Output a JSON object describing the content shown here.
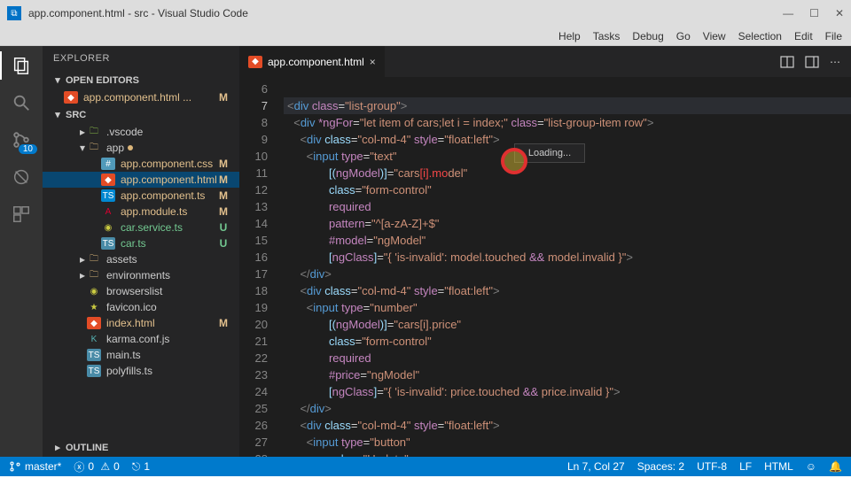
{
  "window": {
    "title": "app.component.html - src - Visual Studio Code"
  },
  "menubar": [
    "Help",
    "Tasks",
    "Debug",
    "Go",
    "View",
    "Selection",
    "Edit",
    "File"
  ],
  "explorer": {
    "title": "EXPLORER",
    "openEditors": "OPEN EDITORS",
    "openItems": [
      {
        "name": "app.component.html  ...",
        "status": "M"
      }
    ],
    "root": "SRC",
    "tree": [
      {
        "name": ".vscode",
        "icon": "folder-green",
        "indent": 2,
        "chev": "right"
      },
      {
        "name": "app",
        "icon": "folder",
        "indent": 2,
        "chev": "down",
        "dot": true
      },
      {
        "name": "app.component.css",
        "icon": "css",
        "indent": 3,
        "status": "M",
        "cls": "M"
      },
      {
        "name": "app.component.html",
        "icon": "html",
        "indent": 3,
        "status": "M",
        "cls": "M",
        "selected": true
      },
      {
        "name": "app.component.ts",
        "icon": "ts",
        "indent": 3,
        "status": "M",
        "cls": "M"
      },
      {
        "name": "app.module.ts",
        "icon": "ang",
        "indent": 3,
        "status": "M",
        "cls": "M"
      },
      {
        "name": "car.service.ts",
        "icon": "yellow",
        "indent": 3,
        "status": "U",
        "cls": "U"
      },
      {
        "name": "car.ts",
        "icon": "ts2",
        "indent": 3,
        "status": "U",
        "cls": "U"
      },
      {
        "name": "assets",
        "icon": "folder",
        "indent": 2,
        "chev": "right"
      },
      {
        "name": "environments",
        "icon": "folder",
        "indent": 2,
        "chev": "right"
      },
      {
        "name": "browserslist",
        "icon": "yellow",
        "indent": 2
      },
      {
        "name": "favicon.ico",
        "icon": "star",
        "indent": 2
      },
      {
        "name": "index.html",
        "icon": "html",
        "indent": 2,
        "status": "M",
        "cls": "M"
      },
      {
        "name": "karma.conf.js",
        "icon": "karma",
        "indent": 2
      },
      {
        "name": "main.ts",
        "icon": "ts2",
        "indent": 2
      },
      {
        "name": "polyfills.ts",
        "icon": "ts2",
        "indent": 2
      }
    ],
    "outline": "OUTLINE"
  },
  "tab": {
    "name": "app.component.html"
  },
  "popup": "Loading...",
  "gutter_start": 6,
  "gutter_end": 28,
  "highlight_line": 7,
  "status": {
    "branch": "master*",
    "errors": "0",
    "warnings": "0",
    "port": "1",
    "cursor": "Ln 7, Col 27",
    "spaces": "Spaces: 2",
    "encoding": "UTF-8",
    "eol": "LF",
    "lang": "HTML"
  },
  "scm_badge": "10"
}
